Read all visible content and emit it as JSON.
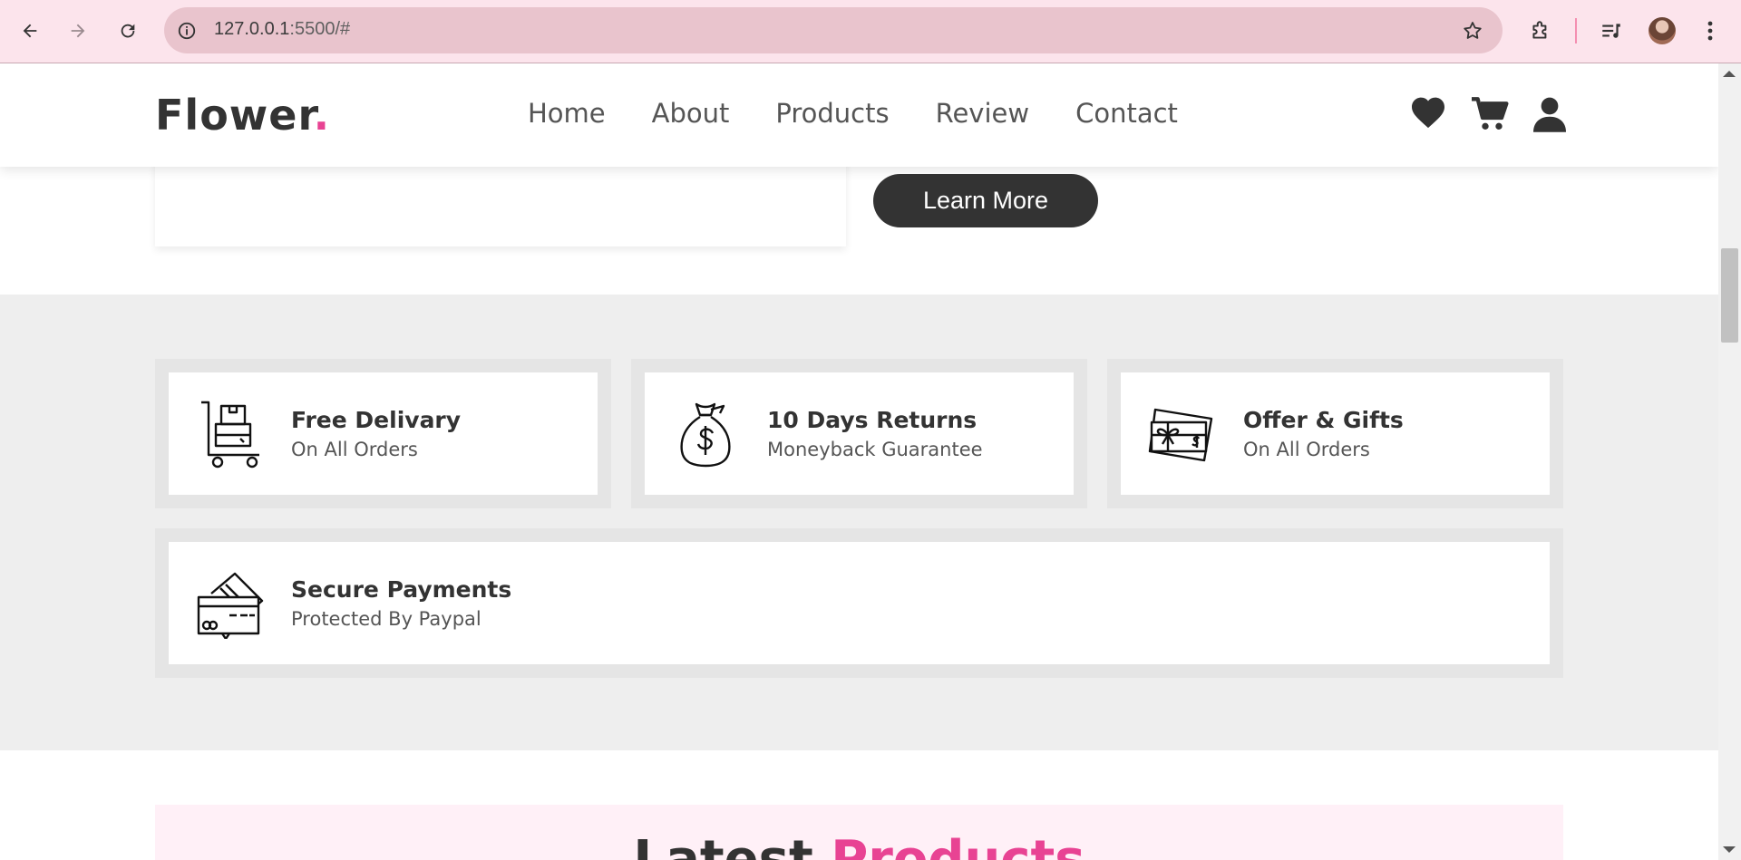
{
  "browser": {
    "url_host": "127.0.0.1",
    "url_rest": ":5500/#",
    "icons": [
      "back-arrow-icon",
      "forward-arrow-icon",
      "reload-icon",
      "site-info-icon",
      "bookmark-star-icon",
      "extensions-icon",
      "media-queue-icon",
      "profile-avatar",
      "more-menu-icon"
    ]
  },
  "header": {
    "logo_text": "Flower",
    "logo_dot": ".",
    "menu": [
      "Home",
      "About",
      "Products",
      "Review",
      "Contact"
    ],
    "icons": [
      "heart-icon",
      "cart-icon",
      "user-icon"
    ]
  },
  "hero": {
    "button_label": "Learn More"
  },
  "features": [
    {
      "title": "Free Delivary",
      "subtitle": "On All Orders",
      "icon": "delivery-cart-icon"
    },
    {
      "title": "10 Days Returns",
      "subtitle": "Moneyback Guarantee",
      "icon": "money-bag-icon"
    },
    {
      "title": "Offer & Gifts",
      "subtitle": "On All Orders",
      "icon": "gift-card-icon"
    },
    {
      "title": "Secure Payments",
      "subtitle": "Protected By Paypal",
      "icon": "credit-card-icon"
    }
  ],
  "products": {
    "heading_main": "Latest",
    "heading_accent": "Products"
  },
  "colors": {
    "accent": "#e84393",
    "dark": "#333333",
    "chrome_bg": "#fce4ec",
    "section_bg": "#eeeeee"
  }
}
